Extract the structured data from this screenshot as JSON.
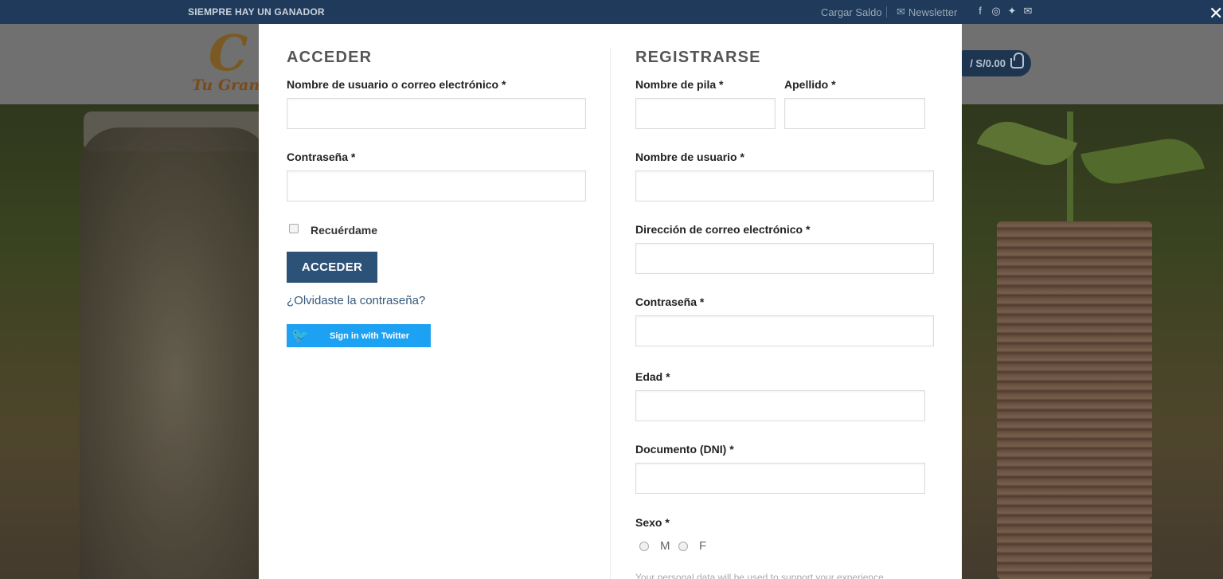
{
  "topbar": {
    "tagline": "SIEMPRE HAY UN GANADOR",
    "saldo": "Cargar Saldo",
    "newsletter": "Newsletter",
    "social_icons": [
      "facebook-icon",
      "instagram-icon",
      "twitter-icon",
      "mail-icon"
    ]
  },
  "header": {
    "logo_mark": "C",
    "logo_text": "Tu Gran",
    "cart_total": "/ S/0.00"
  },
  "modal": {
    "login": {
      "title": "ACCEDER",
      "username_label": "Nombre de usuario o correo electrónico *",
      "password_label": "Contraseña *",
      "remember_label": "Recuérdame",
      "submit_label": "ACCEDER",
      "forgot_label": "¿Olvidaste la contraseña?",
      "twitter_label": "Sign in with Twitter"
    },
    "register": {
      "title": "REGISTRARSE",
      "first_name_label": "Nombre de pila *",
      "last_name_label": "Apellido *",
      "username_label": "Nombre de usuario *",
      "email_label": "Dirección de correo electrónico *",
      "password_label": "Contraseña *",
      "age_label": "Edad *",
      "dni_label": "Documento (DNI) *",
      "sex_label": "Sexo *",
      "sex_options": [
        "M",
        "F"
      ],
      "privacy_text": "Your personal data will be used to support your experience"
    }
  },
  "colors": {
    "topbar_bg": "#1f3a5a",
    "button_bg": "#2d5278",
    "twitter_bg": "#1da1f2"
  }
}
